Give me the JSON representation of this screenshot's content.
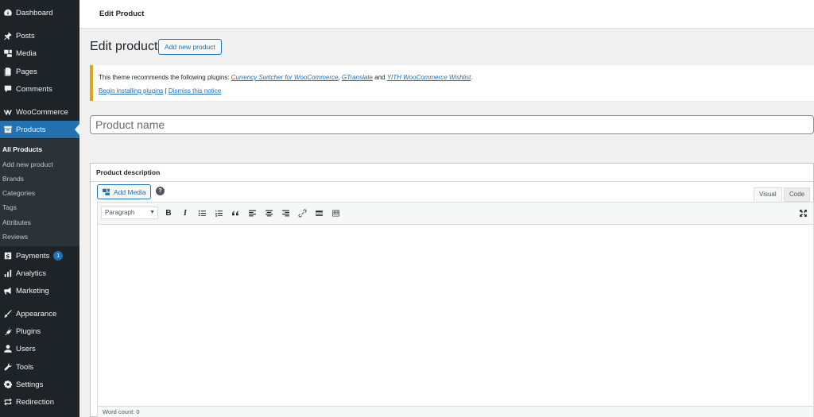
{
  "sidebar": {
    "menu": [
      {
        "label": "Dashboard",
        "icon": "dashboard-icon"
      },
      {
        "label": "Posts",
        "icon": "pin-icon"
      },
      {
        "label": "Media",
        "icon": "media-icon"
      },
      {
        "label": "Pages",
        "icon": "pages-icon"
      },
      {
        "label": "Comments",
        "icon": "comments-icon"
      },
      {
        "label": "WooCommerce",
        "icon": "woocommerce-icon"
      },
      {
        "label": "Products",
        "icon": "archive-icon"
      },
      {
        "label": "Payments",
        "icon": "dollar-icon",
        "badge": "1"
      },
      {
        "label": "Analytics",
        "icon": "bar-chart-icon"
      },
      {
        "label": "Marketing",
        "icon": "megaphone-icon"
      },
      {
        "label": "Appearance",
        "icon": "brush-icon"
      },
      {
        "label": "Plugins",
        "icon": "plug-icon"
      },
      {
        "label": "Users",
        "icon": "user-icon"
      },
      {
        "label": "Tools",
        "icon": "wrench-icon"
      },
      {
        "label": "Settings",
        "icon": "settings-icon"
      },
      {
        "label": "Redirection",
        "icon": "redirect-icon"
      }
    ],
    "submenu": [
      "All Products",
      "Add new product",
      "Brands",
      "Categories",
      "Tags",
      "Attributes",
      "Reviews"
    ],
    "accent_color": "#2271b1",
    "background_color": "#1d2327"
  },
  "topbar": {
    "title": "Edit Product"
  },
  "main": {
    "page_title": "Edit product",
    "add_new_label": "Add new product",
    "notice": {
      "prefix": "This theme recommends the following plugins: ",
      "plugin1": "Currency Switcher for WooCommerce",
      "sep1": ", ",
      "plugin2": "GTranslate",
      "sep2": " and ",
      "plugin3": "YITH WooCommerce Wishlist",
      "suffix": ".",
      "begin_link": "Begin installing plugins",
      "divider": " | ",
      "dismiss_link": "Dismiss this notice",
      "border_color": "#dba617"
    },
    "product_name_placeholder": "Product name",
    "description": {
      "title": "Product description",
      "add_media_label": "Add Media",
      "help": "?",
      "tab_visual": "Visual",
      "tab_code": "Code",
      "format_value": "Paragraph",
      "word_count": "Word count: 0"
    }
  }
}
